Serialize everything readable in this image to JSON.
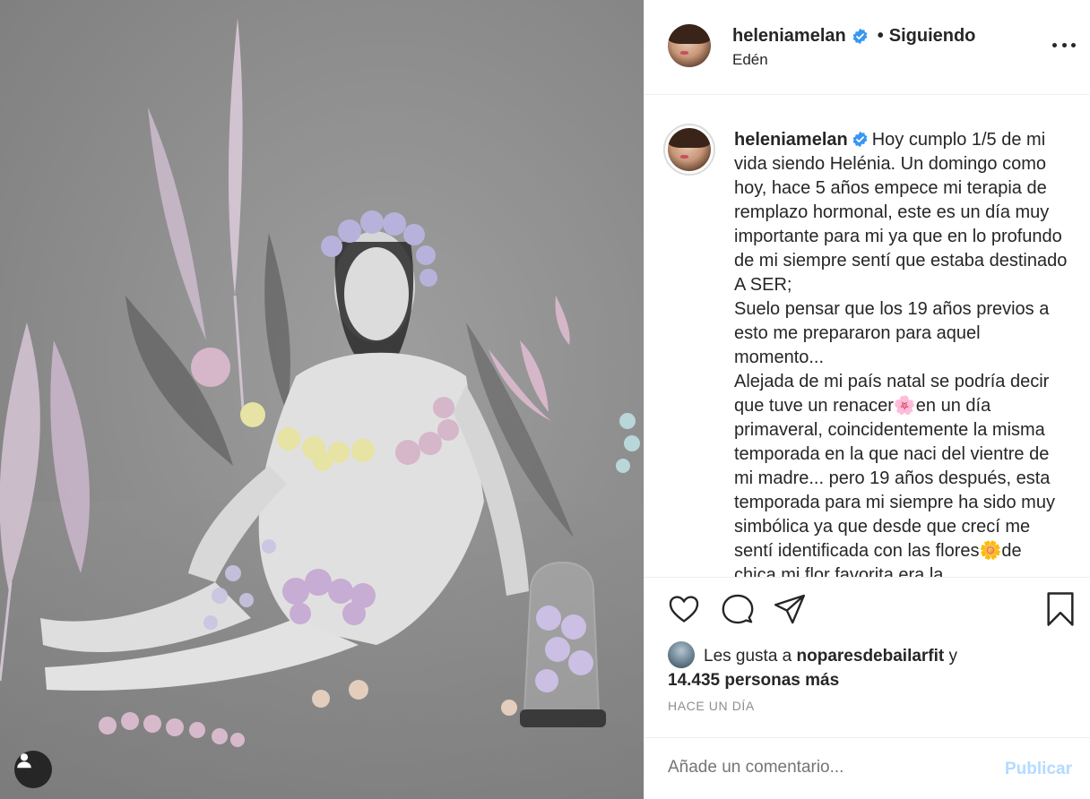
{
  "post": {
    "username": "heleniamelan",
    "follow_status": "Siguiendo",
    "separator": "•",
    "location": "Edén",
    "caption_username": "heleniamelan",
    "caption_text": "Hoy cumplo 1/5 de mi vida siendo Helénia. Un domingo como hoy, hace 5 años empece mi terapia de remplazo hormonal, este es un día muy importante para mi ya que en lo profundo de mi siempre sentí que estaba destinado A SER;\nSuelo pensar que los 19 años previos a esto me prepararon para aquel momento...\nAlejada de mi país natal se podría decir que tuve un renacer🌸en un día primaveral, coincidentemente la misma temporada en la que naci del vientre de mi madre... pero 19 años después, esta temporada para mi siempre ha sido muy simbólica ya que desde que crecí me sentí identificada con las flores🌼de chica mi flor favorita era la",
    "likes_prefix": "Les gusta a",
    "likes_user": "noparesdebailarfit",
    "likes_conjunction": "y",
    "likes_others": "14.435 personas más",
    "timestamp": "HACE UN DÍA",
    "comment_placeholder": "Añade un comentario...",
    "publish_label": "Publicar"
  },
  "icons": {
    "verified": "verified-badge-icon",
    "more": "more-options-icon",
    "like": "heart-icon",
    "comment": "comment-bubble-icon",
    "share": "paper-plane-icon",
    "save": "bookmark-icon",
    "tags": "user-tag-icon"
  },
  "colors": {
    "verified_blue": "#3897f0",
    "publish_disabled": "#b3dbff",
    "muted_text": "#8e8e8e",
    "text": "#262626"
  }
}
